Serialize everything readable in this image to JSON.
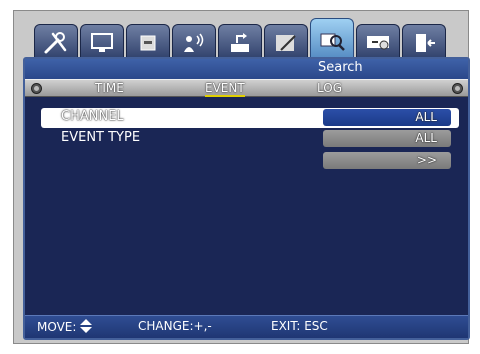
{
  "tabs": [
    {
      "icon": "tools-icon"
    },
    {
      "icon": "monitor-icon"
    },
    {
      "icon": "storage-icon"
    },
    {
      "icon": "network-icon"
    },
    {
      "icon": "device-icon"
    },
    {
      "icon": "system-icon"
    },
    {
      "icon": "search-icon",
      "active": true
    },
    {
      "icon": "backup-icon"
    },
    {
      "icon": "exit-icon"
    }
  ],
  "title": "Search",
  "menu": {
    "items": [
      "TIME",
      "EVENT",
      "LOG"
    ],
    "selected": "EVENT"
  },
  "rows": [
    {
      "label": "CHANNEL",
      "value": "ALL"
    },
    {
      "label": "EVENT TYPE",
      "value": "ALL"
    },
    {
      "label": "",
      "value": ">>"
    }
  ],
  "footer": {
    "move": "MOVE:",
    "change": "CHANGE:+,-",
    "exit": "EXIT: ESC"
  },
  "colors": {
    "panel_bg": "#1a2655",
    "highlight": "#ffffff",
    "selected_value": "#1b3a88",
    "menu_underline": "#e0d000"
  }
}
